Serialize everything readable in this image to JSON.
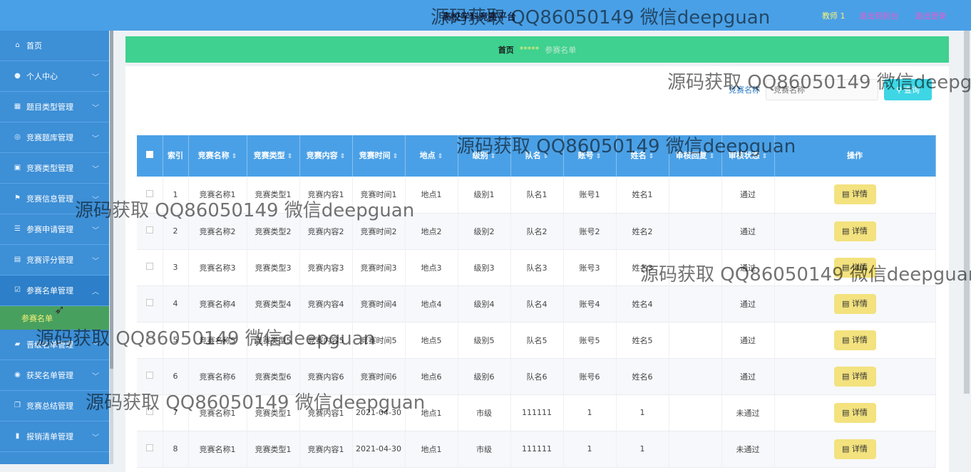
{
  "header": {
    "title": "高校学科竞赛平台",
    "user": "教师 1",
    "to_front": "退出到前台",
    "logout": "退出登录"
  },
  "sidebar": {
    "items": [
      {
        "label": "首页",
        "icon": "home-icon",
        "chevron": false
      },
      {
        "label": "个人中心",
        "icon": "user-icon",
        "chevron": true
      },
      {
        "label": "题目类型管理",
        "icon": "grid-icon",
        "chevron": true
      },
      {
        "label": "竞赛题库管理",
        "icon": "compass-icon",
        "chevron": true
      },
      {
        "label": "竞赛类型管理",
        "icon": "briefcase-icon",
        "chevron": true
      },
      {
        "label": "竞赛信息管理",
        "icon": "flag-icon",
        "chevron": true
      },
      {
        "label": "参赛申请管理",
        "icon": "list-icon",
        "chevron": true
      },
      {
        "label": "竞赛评分管理",
        "icon": "stack-icon",
        "chevron": true
      },
      {
        "label": "参赛名单管理",
        "icon": "check-square-icon",
        "chevron": true
      },
      {
        "label": "晋级名单管理",
        "icon": "car-icon",
        "chevron": true
      },
      {
        "label": "获奖名单管理",
        "icon": "map-pin-icon",
        "chevron": true
      },
      {
        "label": "竞赛总结管理",
        "icon": "copy-icon",
        "chevron": true
      },
      {
        "label": "报销清单管理",
        "icon": "bar-chart-icon",
        "chevron": true
      }
    ],
    "active_sub": "参赛名单"
  },
  "breadcrumb": {
    "home": "首页",
    "sep": "*****",
    "current": "参赛名单"
  },
  "search": {
    "label": "竞赛名称",
    "placeholder": "竞赛名称",
    "button": "查询",
    "button_icon": "search-icon"
  },
  "table": {
    "headers": [
      "索引",
      "竞赛名称",
      "竞赛类型",
      "竞赛内容",
      "竞赛时间",
      "地点",
      "级别",
      "队名",
      "账号",
      "姓名",
      "审核回复",
      "审核状态",
      "操作"
    ],
    "detail_label": "详情",
    "rows": [
      [
        "1",
        "竞赛名称1",
        "竞赛类型1",
        "竞赛内容1",
        "竞赛时间1",
        "地点1",
        "级别1",
        "队名1",
        "账号1",
        "姓名1",
        "",
        "通过"
      ],
      [
        "2",
        "竞赛名称2",
        "竞赛类型2",
        "竞赛内容2",
        "竞赛时间2",
        "地点2",
        "级别2",
        "队名2",
        "账号2",
        "姓名2",
        "",
        "通过"
      ],
      [
        "3",
        "竞赛名称3",
        "竞赛类型3",
        "竞赛内容3",
        "竞赛时间3",
        "地点3",
        "级别3",
        "队名3",
        "账号3",
        "姓名3",
        "",
        "通过"
      ],
      [
        "4",
        "竞赛名称4",
        "竞赛类型4",
        "竞赛内容4",
        "竞赛时间4",
        "地点4",
        "级别4",
        "队名4",
        "账号4",
        "姓名4",
        "",
        "通过"
      ],
      [
        "5",
        "竞赛名称5",
        "竞赛类型5",
        "竞赛内容5",
        "竞赛时间5",
        "地点5",
        "级别5",
        "队名5",
        "账号5",
        "姓名5",
        "",
        "通过"
      ],
      [
        "6",
        "竞赛名称6",
        "竞赛类型6",
        "竞赛内容6",
        "竞赛时间6",
        "地点6",
        "级别6",
        "队名6",
        "账号6",
        "姓名6",
        "",
        "通过"
      ],
      [
        "7",
        "竞赛名称1",
        "竞赛类型1",
        "竞赛内容1",
        "2021-04-30",
        "地点1",
        "市级",
        "111111",
        "1",
        "1",
        "",
        "未通过"
      ],
      [
        "8",
        "竞赛名称1",
        "竞赛类型1",
        "竞赛内容1",
        "2021-04-30",
        "地点1",
        "市级",
        "111111",
        "1",
        "1",
        "",
        "未通过"
      ]
    ]
  },
  "watermark": "源码获取 QQ86050149 微信deepguan",
  "colors": {
    "topbar": "#4aa0e6",
    "sidebar": "#3d8fd6",
    "breadcrumb": "#3fd18f",
    "detail_button": "#f3e27e",
    "search_button": "#3ed6e5"
  }
}
